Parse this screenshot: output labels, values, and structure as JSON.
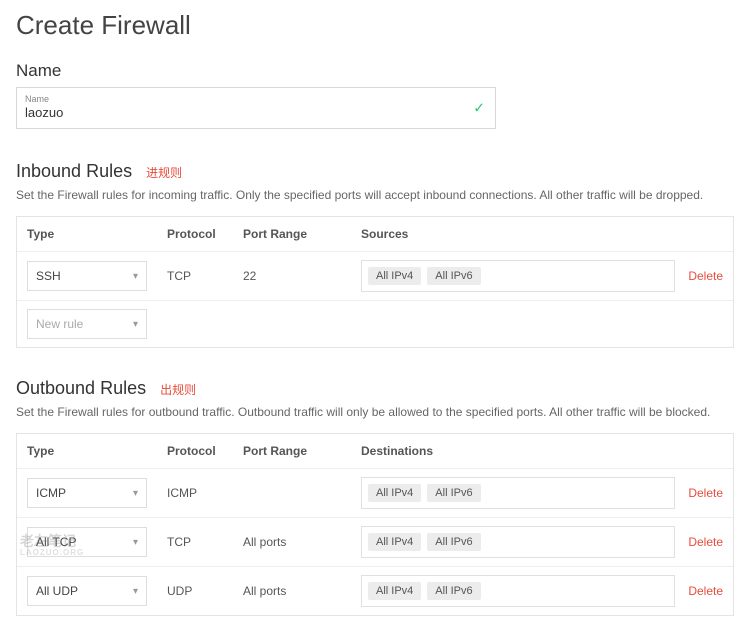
{
  "page_title": "Create Firewall",
  "name_section": {
    "label": "Name",
    "field_tiny_label": "Name",
    "value": "laozuo"
  },
  "inbound": {
    "title": "Inbound Rules",
    "annotation": "进规则",
    "description": "Set the Firewall rules for incoming traffic. Only the specified ports will accept inbound connections. All other traffic will be dropped.",
    "columns": {
      "type": "Type",
      "protocol": "Protocol",
      "port_range": "Port Range",
      "sources": "Sources"
    },
    "rows": [
      {
        "type": "SSH",
        "protocol": "TCP",
        "port_range": "22",
        "sources": [
          "All IPv4",
          "All IPv6"
        ],
        "delete_label": "Delete"
      }
    ],
    "new_rule_placeholder": "New rule"
  },
  "outbound": {
    "title": "Outbound Rules",
    "annotation": "出规则",
    "description": "Set the Firewall rules for outbound traffic. Outbound traffic will only be allowed to the specified ports. All other traffic will be blocked.",
    "columns": {
      "type": "Type",
      "protocol": "Protocol",
      "port_range": "Port Range",
      "destinations": "Destinations"
    },
    "rows": [
      {
        "type": "ICMP",
        "protocol": "ICMP",
        "port_range": "",
        "destinations": [
          "All IPv4",
          "All IPv6"
        ],
        "delete_label": "Delete"
      },
      {
        "type": "All TCP",
        "protocol": "TCP",
        "port_range": "All ports",
        "destinations": [
          "All IPv4",
          "All IPv6"
        ],
        "delete_label": "Delete"
      },
      {
        "type": "All UDP",
        "protocol": "UDP",
        "port_range": "All ports",
        "destinations": [
          "All IPv4",
          "All IPv6"
        ],
        "delete_label": "Delete"
      }
    ]
  },
  "watermark": {
    "main": "老左笔记",
    "sub": "LAOZUO.ORG"
  }
}
